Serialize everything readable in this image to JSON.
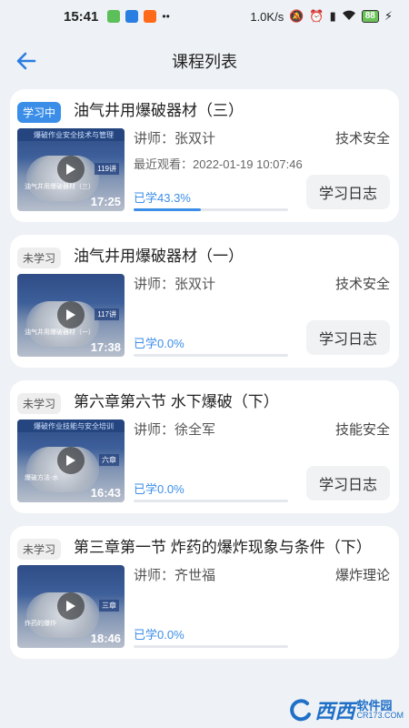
{
  "status_bar": {
    "time": "15:41",
    "speed": "1.0K/s",
    "battery": "88"
  },
  "header": {
    "title": "课程列表"
  },
  "courses": [
    {
      "status": "学习中",
      "title": "油气井用爆破器材（三）",
      "thumb_banner": "爆破作业安全技术与管理",
      "thumb_lessons": "119讲",
      "thumb_subtitle": "油气井用爆破器材（三）",
      "duration": "17:25",
      "teacher": "讲师：张双计",
      "category": "技术安全",
      "recent": "最近观看：2022-01-19 10:07:46",
      "progress_text": "已学43.3%",
      "progress": 0.433,
      "log_button": "学习日志"
    },
    {
      "status": "未学习",
      "title": "油气井用爆破器材（一）",
      "thumb_banner": "",
      "thumb_lessons": "117讲",
      "thumb_subtitle": "油气井用爆破器材（一）",
      "duration": "17:38",
      "teacher": "讲师：张双计",
      "category": "技术安全",
      "recent": "",
      "progress_text": "已学0.0%",
      "progress": 0,
      "log_button": "学习日志"
    },
    {
      "status": "未学习",
      "title": "第六章第六节 水下爆破（下）",
      "thumb_banner": "爆破作业技能与安全培训",
      "thumb_lessons": "六章",
      "thumb_subtitle": "爆破方法-水",
      "duration": "16:43",
      "teacher": "讲师：徐全军",
      "category": "技能安全",
      "recent": "",
      "progress_text": "已学0.0%",
      "progress": 0,
      "log_button": "学习日志"
    },
    {
      "status": "未学习",
      "title": "第三章第一节 炸药的爆炸现象与条件（下）",
      "thumb_banner": "",
      "thumb_lessons": "三章",
      "thumb_subtitle": "炸药的爆炸",
      "duration": "18:46",
      "teacher": "讲师：齐世福",
      "category": "爆炸理论",
      "recent": "",
      "progress_text": "已学0.0%",
      "progress": 0,
      "log_button": ""
    }
  ],
  "watermark": {
    "main": "西西",
    "side_top": "软件园",
    "side_bottom": "CR173.COM"
  },
  "colors": {
    "accent": "#3b8ee8",
    "background": "#eef1f5"
  }
}
